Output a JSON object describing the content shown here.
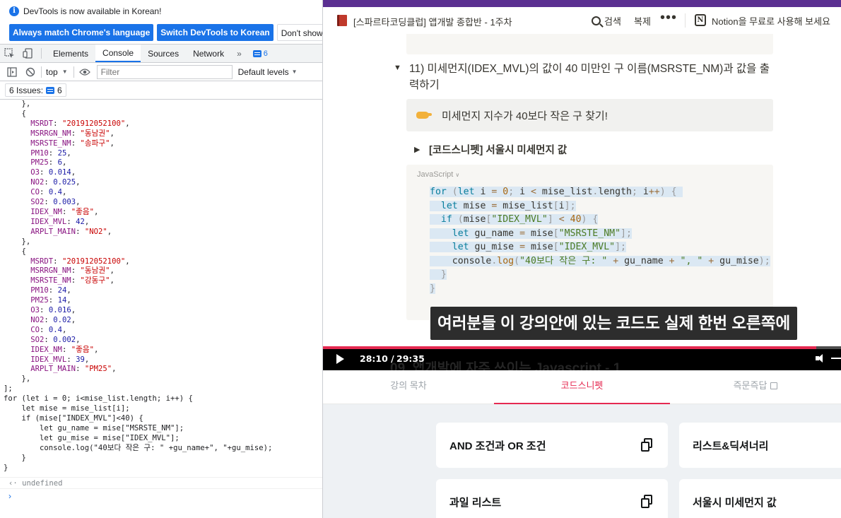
{
  "devtools": {
    "notice_text": "DevTools is now available in Korean!",
    "btn_match_language": "Always match Chrome's language",
    "btn_switch_korean": "Switch DevTools to Korean",
    "btn_dont_show": "Don't show agai",
    "tabs": [
      "Elements",
      "Console",
      "Sources",
      "Network"
    ],
    "active_tab": "Console",
    "more_tabs": "»",
    "tab_badge_count": "6",
    "context_select": "top",
    "filter_placeholder": "Filter",
    "default_levels": "Default levels",
    "issues_label": "6 Issues:",
    "issues_count": "6",
    "undefined_text": "undefined",
    "prompt_symbol": "›",
    "return_symbol": "‹·",
    "entries": [
      {
        "MSRDT": "\"201912052100\"",
        "MSRRGN_NM": "\"동남권\"",
        "MSRSTE_NM": "\"송파구\"",
        "PM10": "25",
        "PM25": "6",
        "O3": "0.014",
        "NO2": "0.025",
        "CO": "0.4",
        "SO2": "0.003",
        "IDEX_NM": "\"좋음\"",
        "IDEX_MVL": "42",
        "ARPLT_MAIN": "\"NO2\""
      },
      {
        "MSRDT": "\"201912052100\"",
        "MSRRGN_NM": "\"동남권\"",
        "MSRSTE_NM": "\"강동구\"",
        "PM10": "24",
        "PM25": "14",
        "O3": "0.016",
        "NO2": "0.02",
        "CO": "0.4",
        "SO2": "0.002",
        "IDEX_NM": "\"좋음\"",
        "IDEX_MVL": "39",
        "ARPLT_MAIN": "\"PM25\""
      }
    ],
    "loop_code": [
      "for (let i = 0; i<mise_list.length; i++) {",
      "    let mise = mise_list[i];",
      "    if (mise[\"INDEX_MVL\"]<40) {",
      "        let gu_name = mise[\"MSRSTE_NM\"];",
      "        let gu_mise = mise[\"IDEX_MVL\"];",
      "        console.log(\"40보다 작은 구: \" +gu_name+\", \"+gu_mise);",
      "    }",
      "}"
    ]
  },
  "notion": {
    "page_title": "[스파르타코딩클럽] 앱개발 종합반 - 1주차",
    "search_label": "검색",
    "duplicate_label": "복제",
    "more_label": "•••",
    "notion_logo": "N",
    "try_notion": "Notion을 무료로 사용해 보세요",
    "question_title": "11) 미세먼지(IDEX_MVL)의 값이 40 미만인 구 이름(MSRSTE_NM)과 값을 출력하기",
    "callout_text": "미세먼지 지수가 40보다 작은 구 찾기!",
    "snippet_toggle": "[코드스니펫] 서울시 미세먼지 값",
    "code_language": "JavaScript",
    "subtitle": "여러분들 이 강의안에 있는 코드도 실제 한번 오른쪽에",
    "behind_title": "09. 앱개발에 자주 쓰이는 Javascript - 1"
  },
  "video": {
    "current_time": "28:10 /",
    "duration": "29:35",
    "progress": 0.952
  },
  "lesson_tabs": {
    "toc": "강의 목차",
    "snippets": "코드스니펫",
    "qa": "즉문즉답"
  },
  "snippets": [
    "AND 조건과 OR 조건",
    "리스트&딕셔너리",
    "과일 리스트",
    "서울시 미세먼지 값"
  ]
}
